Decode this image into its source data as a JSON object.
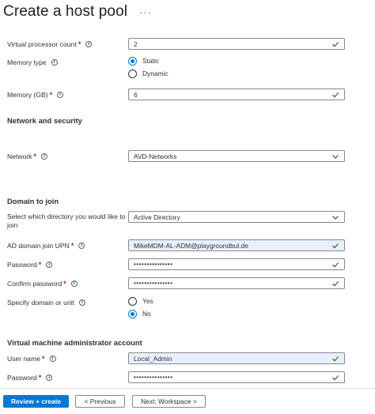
{
  "page": {
    "title": "Create a host pool",
    "more_glyph": "···"
  },
  "vm": {
    "vcpu_label": "Virtual processor count",
    "vcpu_value": "2",
    "memory_type_label": "Memory type",
    "memory_type_options": [
      "Static",
      "Dynamic"
    ],
    "memory_type_selected": "Static",
    "memory_gb_label": "Memory (GB)",
    "memory_gb_value": "6"
  },
  "network": {
    "heading": "Network and security",
    "network_label": "Network",
    "network_value": "AVD-Networks"
  },
  "domain": {
    "heading": "Domain to join",
    "directory_label_line1": "Select which directory you would like to",
    "directory_label_line2": "join",
    "directory_value": "Active Directory",
    "upn_label": "AD domain join UPN",
    "upn_value": "MikeMDM-AL-ADM@playgroundbul.de",
    "password_label": "Password",
    "password_value": "•••••••••••••••",
    "confirm_label": "Confirm password",
    "confirm_value": "•••••••••••••••",
    "specify_label": "Specify domain or unit",
    "specify_options": [
      "Yes",
      "No"
    ],
    "specify_selected": "No"
  },
  "admin": {
    "heading": "Virtual machine administrator account",
    "username_label": "User name",
    "username_value": "Local_Admin",
    "password_label": "Password",
    "password_value": "•••••••••••••••"
  },
  "footer": {
    "review_label": "Review + create",
    "previous_label": "< Previous",
    "next_label": "Next: Workspace >"
  },
  "colors": {
    "accent": "#0078d4",
    "valid": "#107c10",
    "required": "#a4262c",
    "field_highlight": "#e8f0fe"
  },
  "icons": {
    "info": "info-icon",
    "check": "check-icon",
    "chevron": "chevron-down-icon"
  }
}
